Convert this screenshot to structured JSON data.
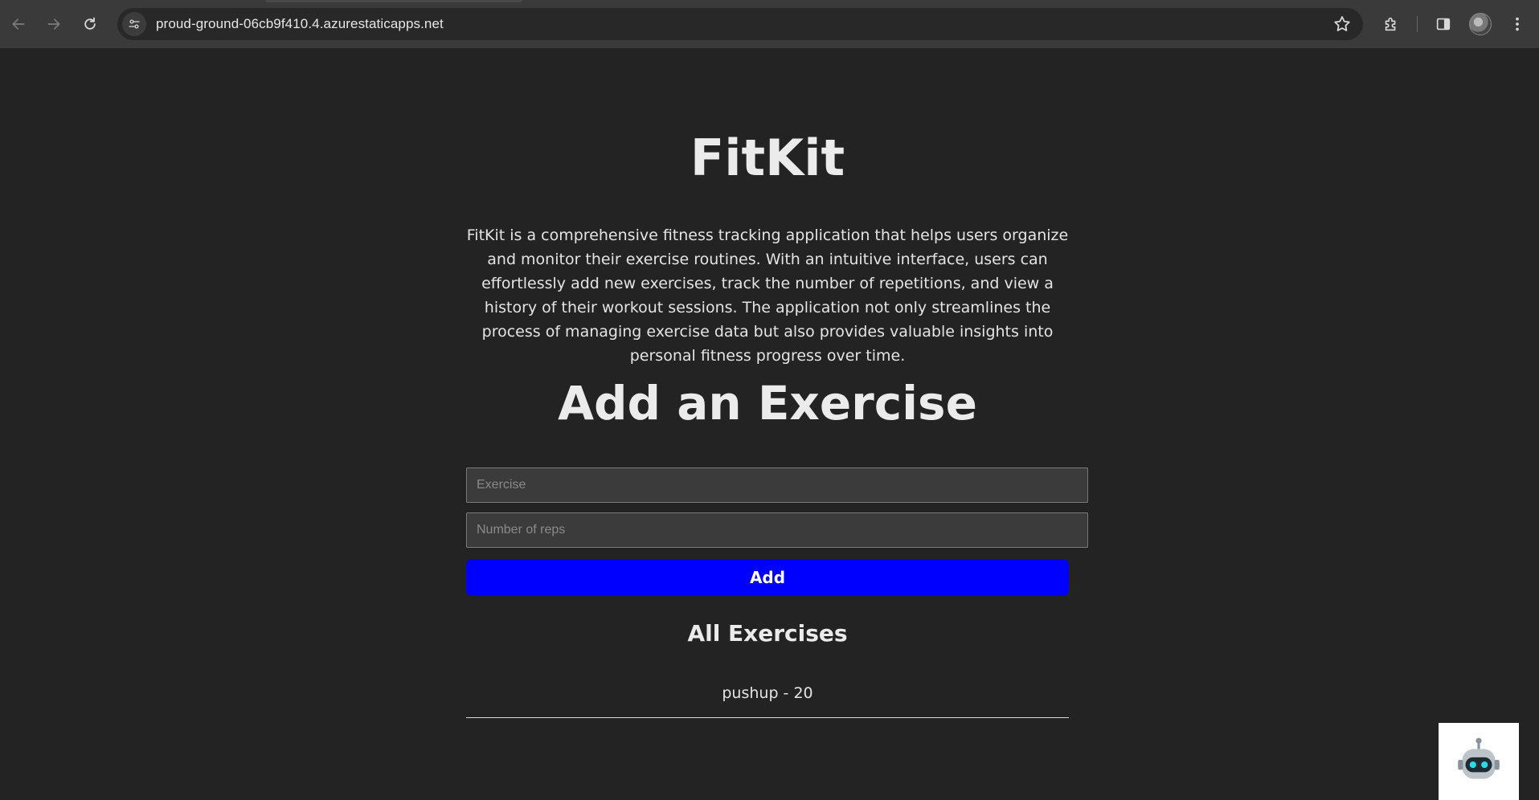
{
  "browser": {
    "url": "proud-ground-06cb9f410.4.azurestaticapps.net"
  },
  "app": {
    "title": "FitKit",
    "description": "FitKit is a comprehensive fitness tracking application that helps users organize and monitor their exercise routines. With an intuitive interface, users can effortlessly add new exercises, track the number of repetitions, and view a history of their workout sessions. The application not only streamlines the process of managing exercise data but also provides valuable insights into personal fitness progress over time.",
    "form": {
      "heading": "Add an Exercise",
      "exercise_placeholder": "Exercise",
      "reps_placeholder": "Number of reps",
      "add_label": "Add"
    },
    "list": {
      "heading": "All Exercises",
      "items": [
        "pushup - 20"
      ]
    }
  },
  "colors": {
    "page_bg": "#232323",
    "button_bg": "#0000ff",
    "chrome_bg": "#3a3a3a"
  },
  "icons": {
    "back": "arrow-left-icon",
    "forward": "arrow-right-icon",
    "reload": "reload-icon",
    "site_info": "site-info-icon",
    "bookmark": "star-icon",
    "extensions": "puzzle-icon",
    "side_panel": "side-panel-icon",
    "menu": "kebab-menu-icon",
    "chatbot": "robot-icon"
  }
}
